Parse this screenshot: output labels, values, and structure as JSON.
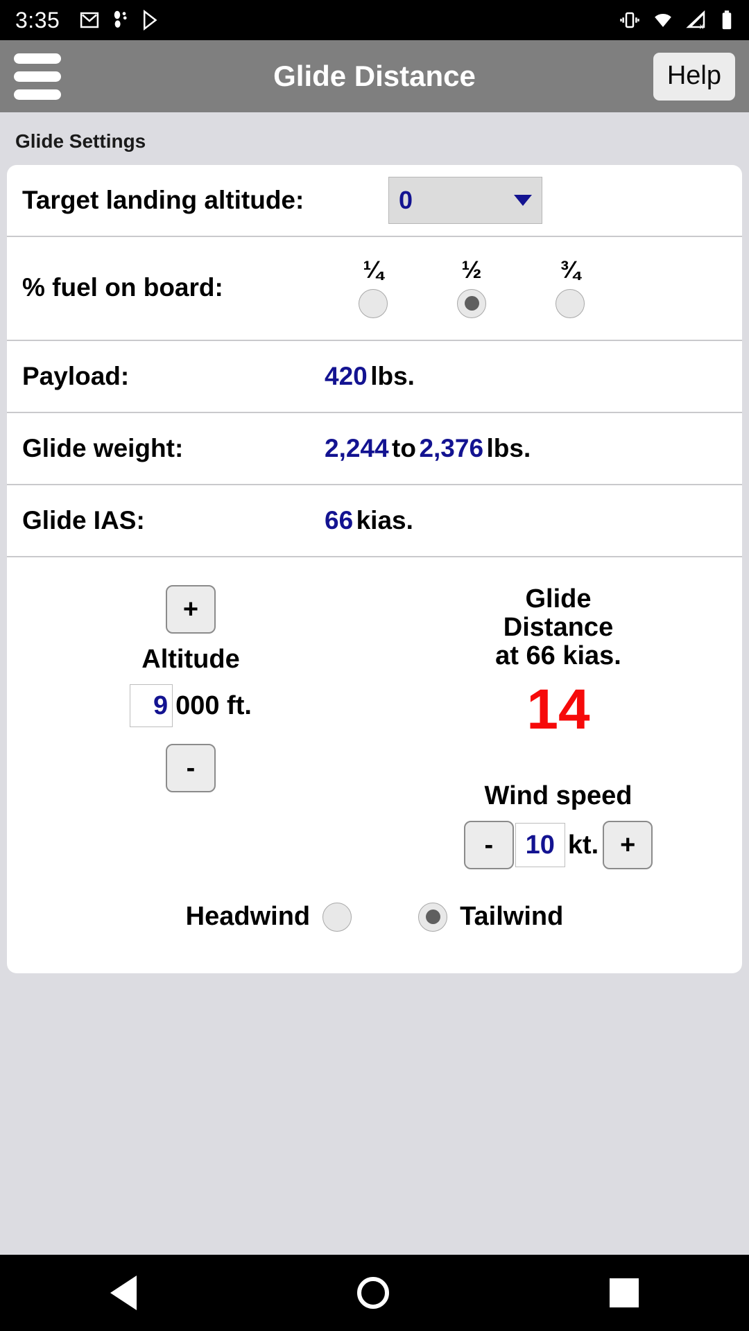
{
  "statusbar": {
    "time": "3:35",
    "left_icons": [
      "gmail-icon",
      "footprints-icon",
      "play-store-icon"
    ],
    "right_icons": [
      "vibrate-icon",
      "wifi-icon",
      "signal-off-icon",
      "battery-icon"
    ]
  },
  "appbar": {
    "menu_icon": "hamburger-menu-icon",
    "title": "Glide Distance",
    "help_label": "Help"
  },
  "section": {
    "header": "Glide Settings"
  },
  "rows": {
    "target_altitude": {
      "label": "Target landing altitude:",
      "value": "0",
      "caret_icon": "chevron-down-icon"
    },
    "fuel": {
      "label": "% fuel on board:",
      "options": [
        {
          "label": "¼",
          "selected": false
        },
        {
          "label": "½",
          "selected": true
        },
        {
          "label": "¾",
          "selected": false
        }
      ]
    },
    "payload": {
      "label": "Payload:",
      "value": "420",
      "unit": "lbs."
    },
    "glide_weight": {
      "label": "Glide weight:",
      "value_low": "2,244",
      "joiner": "to",
      "value_high": "2,376",
      "unit": "lbs."
    },
    "glide_ias": {
      "label": "Glide IAS:",
      "value": "66",
      "unit": "kias."
    }
  },
  "calc": {
    "altitude": {
      "plus_label": "+",
      "minus_label": "-",
      "label": "Altitude",
      "value": "9",
      "suffix": "000 ft."
    },
    "result": {
      "title_line1": "Glide",
      "title_line2": "Distance",
      "title_line3": "at 66 kias.",
      "value": "14",
      "value_color": "#f60a0a"
    },
    "wind": {
      "label": "Wind speed",
      "minus_label": "-",
      "value": "10",
      "unit": "kt.",
      "plus_label": "+"
    },
    "wind_direction": {
      "headwind_label": "Headwind",
      "headwind_selected": false,
      "tailwind_label": "Tailwind",
      "tailwind_selected": true
    }
  },
  "navbar": {
    "back": "back-icon",
    "home": "home-icon",
    "recent": "recent-apps-icon"
  },
  "colors": {
    "accent_blue": "#131391",
    "result_red": "#f60a0a",
    "appbar_gray": "#7f7f7f",
    "page_bg": "#dcdce1"
  }
}
